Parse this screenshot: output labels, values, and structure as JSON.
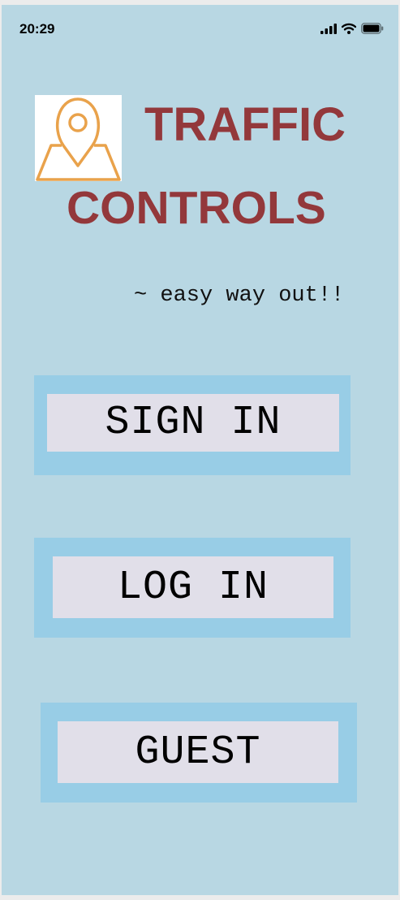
{
  "status_bar": {
    "time": "20:29",
    "icons": [
      "signal-bars-icon",
      "wifi-icon",
      "battery-icon"
    ]
  },
  "logo": {
    "icon": "map-pin-icon",
    "color": "#e9a24b"
  },
  "title": {
    "line1": "TRAFFIC",
    "line2": "CONTROLS",
    "color": "#93383b"
  },
  "tagline": "~ easy way out!!",
  "buttons": {
    "sign_in": "SIGN IN",
    "log_in": "LOG IN",
    "guest": "GUEST"
  },
  "colors": {
    "background": "#b8d7e3",
    "button_frame": "#98cde6",
    "button_fill": "#e1dfe9"
  }
}
